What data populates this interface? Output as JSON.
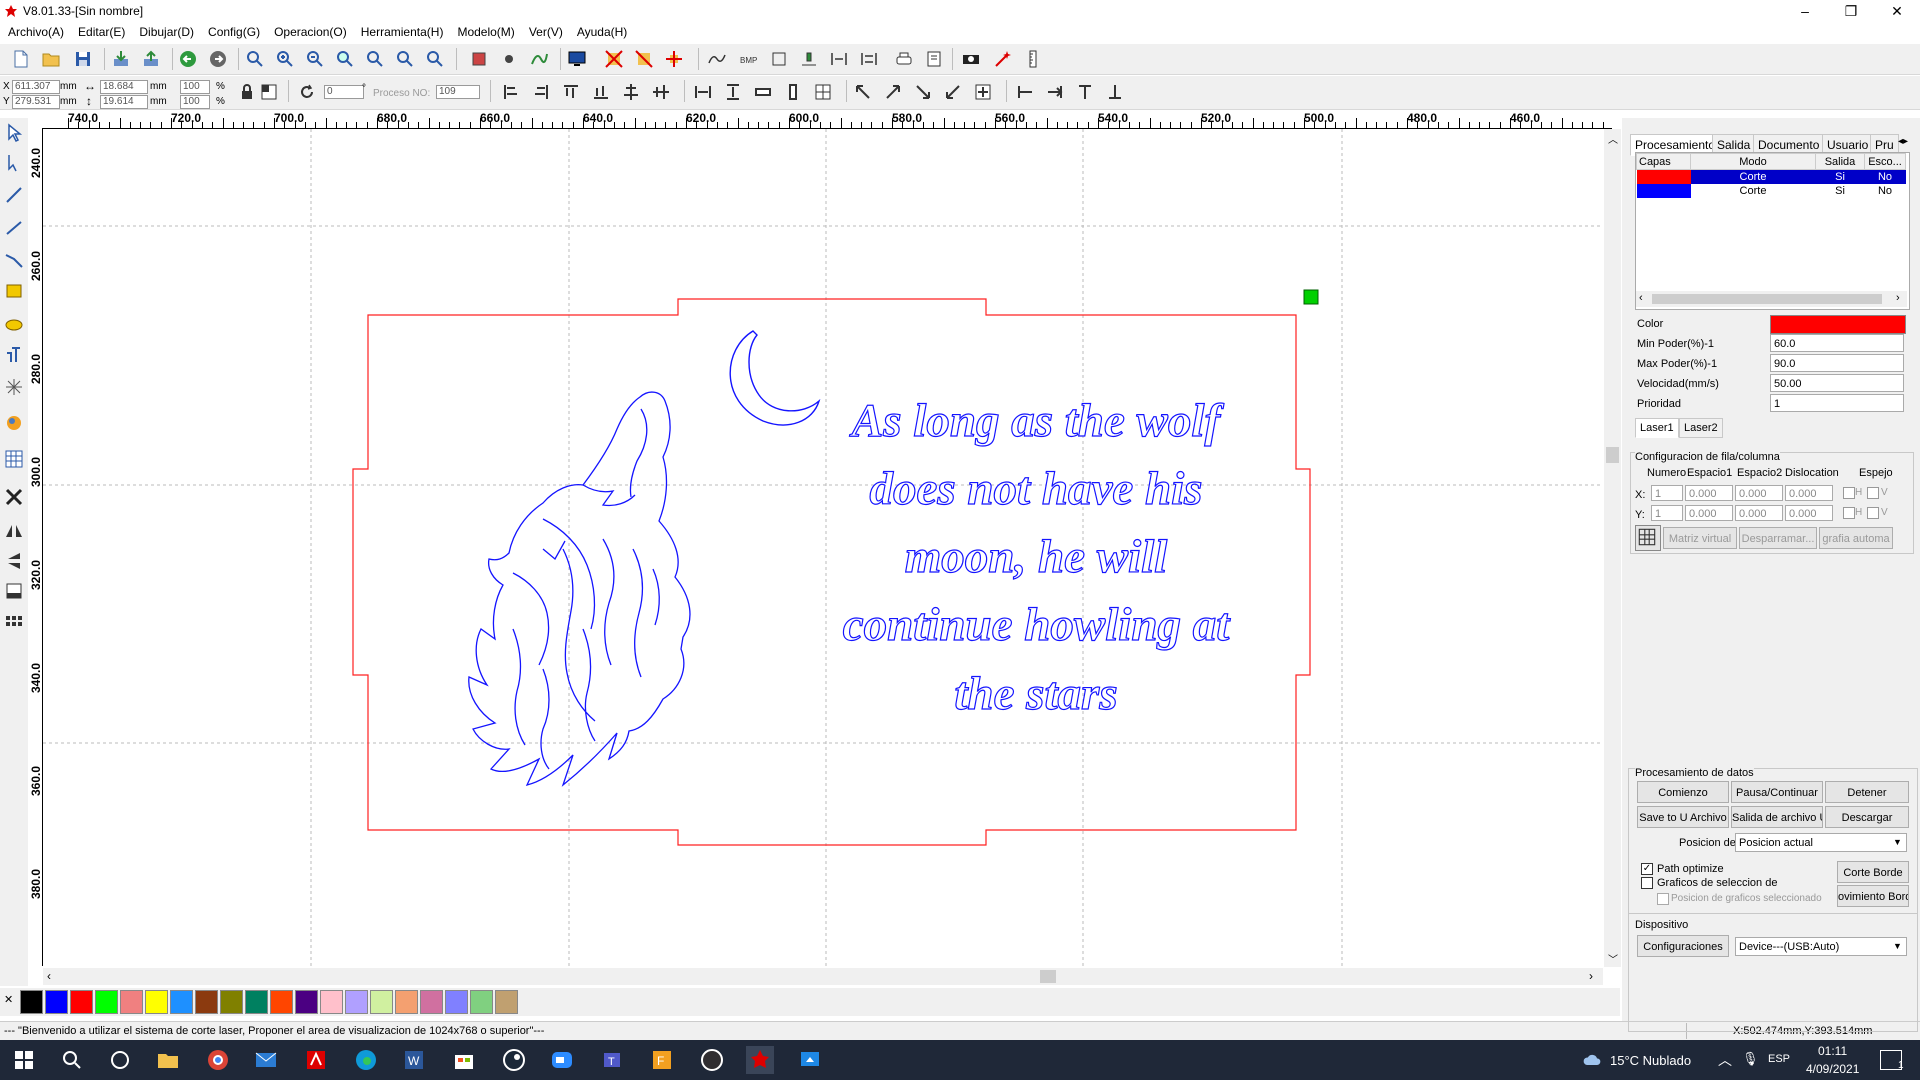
{
  "window": {
    "title": "V8.01.33-[Sin nombre]",
    "controls": [
      "–",
      "❐",
      "✕"
    ]
  },
  "menu": [
    "Archivo(A)",
    "Editar(E)",
    "Dibujar(D)",
    "Config(G)",
    "Operacion(O)",
    "Herramienta(H)",
    "Modelo(M)",
    "Ver(V)",
    "Ayuda(H)"
  ],
  "coords": {
    "x_label": "X",
    "y_label": "Y",
    "x_value": "611.307",
    "y_value": "279.531",
    "unit": "mm",
    "w_value": "18.684",
    "h_value": "19.614",
    "pct_w": "100",
    "pct_h": "100",
    "pct": "%",
    "angle_value": "0",
    "angle_unit": "°",
    "proceso_label": "Proceso NO:",
    "proceso_value": "109"
  },
  "ruler": {
    "h_labels": [
      "740.0",
      "720.0",
      "700.0",
      "680.0",
      "660.0",
      "640.0",
      "620.0",
      "600.0",
      "580.0",
      "560.0",
      "540.0",
      "520.0",
      "500.0",
      "480.0",
      "460.0"
    ],
    "v_labels": [
      "240.0",
      "260.0",
      "280.0",
      "300.0",
      "320.0",
      "340.0",
      "360.0",
      "380.0"
    ]
  },
  "canvas_text": [
    "As long as the wolf",
    "does not have his",
    "moon, he will",
    "continue howling at",
    "the stars"
  ],
  "palette": [
    "#000000",
    "#0000ff",
    "#ff0000",
    "#00ff00",
    "#f08080",
    "#ffff00",
    "#1e90ff",
    "#8b3a0f",
    "#808000",
    "#008060",
    "#ff4500",
    "#4b0082",
    "#ffc0cb",
    "#b0a0ff",
    "#d0f0a0",
    "#f4a070",
    "#d070a0",
    "#8080ff",
    "#80d080",
    "#c0a070"
  ],
  "status": {
    "message": "--- \"Bienvenido a utilizar el sistema de corte laser, Proponer el area de visualizacion de 1024x768 o superior\"---",
    "position": "X:502.474mm,Y:393.514mm"
  },
  "right_panel": {
    "tabs": [
      "Procesamiento",
      "Salida",
      "Documento",
      "Usuario",
      "Pru"
    ],
    "layer_headers": [
      "Capas",
      "Modo",
      "Salida",
      "Esco..."
    ],
    "layers": [
      {
        "color": "#ff0000",
        "mode": "Corte",
        "output": "Si",
        "esco": "No"
      },
      {
        "color": "#0000ff",
        "mode": "Corte",
        "output": "Si",
        "esco": "No"
      }
    ],
    "props": [
      {
        "label": "Color",
        "value": ""
      },
      {
        "label": "Min Poder(%)-1",
        "value": "60.0"
      },
      {
        "label": "Max Poder(%)-1",
        "value": "90.0"
      },
      {
        "label": "Velocidad(mm/s)",
        "value": "50.00"
      },
      {
        "label": "Prioridad",
        "value": "1"
      }
    ],
    "laser_tabs": [
      "Laser1",
      "Laser2"
    ],
    "array": {
      "title": "Configuracion de fila/columna",
      "headers": [
        "Numero",
        "Espacio1",
        "Espacio2",
        "Dislocation",
        "Espejo"
      ],
      "x_label": "X:",
      "y_label": "Y:",
      "x_vals": [
        "1",
        "0.000",
        "0.000",
        "0.000"
      ],
      "y_vals": [
        "1",
        "0.000",
        "0.000",
        "0.000"
      ],
      "h_label": "H",
      "v_label": "V",
      "buttons": [
        "Matriz virtual",
        "Desparramar...",
        "grafia automa"
      ]
    },
    "data_proc": {
      "title": "Procesamiento de datos",
      "start": "Comienzo",
      "pause": "Pausa/Continuar",
      "stop": "Detener",
      "save_u": "Save to U Archivo",
      "out_u": "Salida de archivo U",
      "download": "Descargar",
      "position_label": "Posicion de",
      "position_value": "Posicion actual",
      "path_opt": "Path optimize",
      "graphics_sel": "Graficos de seleccion de",
      "graphics_pos": "Posicion de graficos seleccionado",
      "corte_borde": "Corte Borde",
      "mov_borde": "ovimiento Bord"
    },
    "device": {
      "title": "Dispositivo",
      "config": "Configuraciones",
      "value": "Device---(USB:Auto)"
    }
  },
  "taskbar": {
    "weather": "15°C  Nublado",
    "lang": "ESP",
    "time": "01:11",
    "date": "4/09/2021",
    "notif": "1"
  }
}
